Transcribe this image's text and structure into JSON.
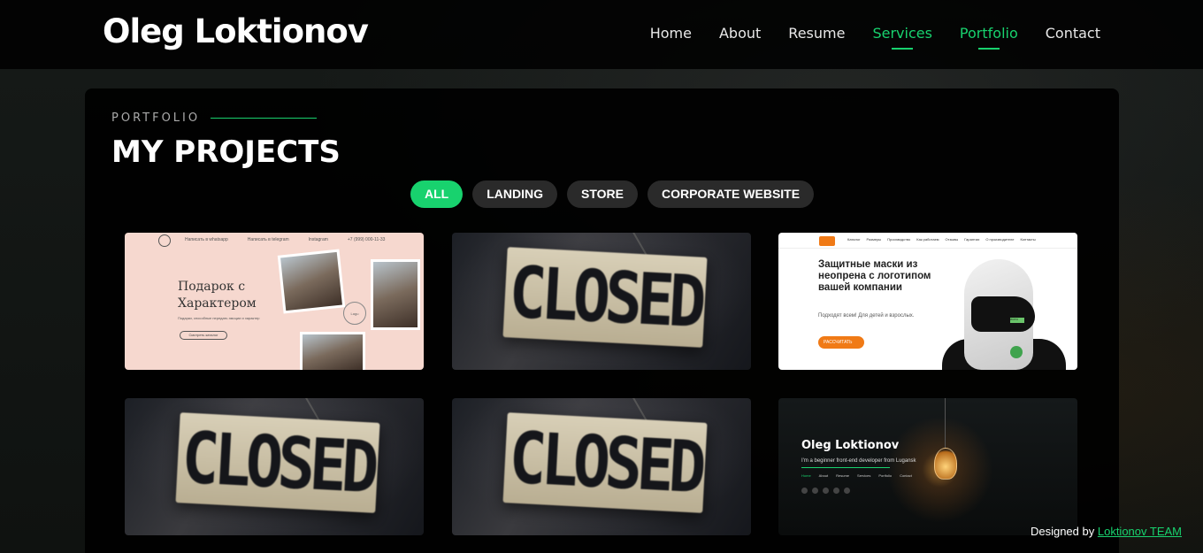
{
  "header": {
    "logo": "Oleg Loktionov",
    "nav": [
      "Home",
      "About",
      "Resume",
      "Services",
      "Portfolio",
      "Contact"
    ]
  },
  "section": {
    "label": "PORTFOLIO",
    "title": "MY PROJECTS"
  },
  "filters": [
    "ALL",
    "LANDING",
    "STORE",
    "CORPORATE WEBSITE"
  ],
  "projects": {
    "gift": {
      "topbar": [
        "Написать в whatsapp",
        "Написать в telegram",
        "Instagram",
        "+7 (999) 000-11-33"
      ],
      "title": "Подарок с Характером",
      "sub": "Подарки, способные передать эмоции и характер",
      "button": "Смотреть каталог",
      "stamp": "Lagu"
    },
    "closed_text": "CLOSED",
    "masks": {
      "nav": [
        "Каталог",
        "Размеры",
        "Производство",
        "Как работаем",
        "Отзывы",
        "Гарантии",
        "О производителе",
        "Контакты"
      ],
      "title": "Защитные маски из неопрена с логотипом вашей компании",
      "sub": "Подходят всем! Для детей и взрослых.",
      "button": "РАССЧИТАТЬ",
      "mask_logo": "ЛОГО"
    },
    "dark": {
      "logo": "Oleg Loktionov",
      "sub": "I'm a beginner front-end developer from Lugansk",
      "nav": [
        "Home",
        "About",
        "Resume",
        "Services",
        "Portfolio",
        "Contact"
      ]
    }
  },
  "footer": {
    "credit_prefix": "Designed by",
    "credit_link": "Loktionov TEAM"
  },
  "colors": {
    "accent": "#18d26e",
    "background": "#0b0d0c",
    "filter_bg": "#2a2a2a"
  }
}
